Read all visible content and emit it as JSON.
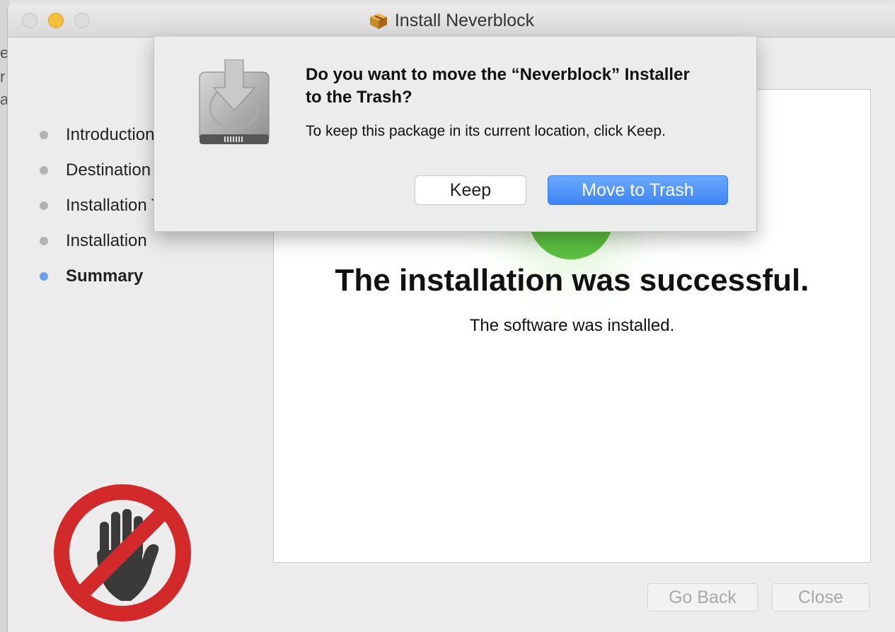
{
  "window": {
    "title": "Install Neverblock"
  },
  "background_window": {
    "letters": [
      "e",
      "r",
      "a"
    ]
  },
  "sidebar": {
    "steps": [
      {
        "label": "Introduction",
        "active": false
      },
      {
        "label": "Destination Select",
        "active": false
      },
      {
        "label": "Installation Type",
        "active": false
      },
      {
        "label": "Installation",
        "active": false
      },
      {
        "label": "Summary",
        "active": true
      }
    ]
  },
  "main": {
    "title": "The installation was successful.",
    "subtitle": "The software was installed."
  },
  "footer": {
    "go_back": "Go Back",
    "close": "Close"
  },
  "dialog": {
    "title": "Do you want to move the “Neverblock” Installer to the Trash?",
    "message": "To keep this package in its current location, click Keep.",
    "keep_label": "Keep",
    "trash_label": "Move to Trash"
  },
  "colors": {
    "accent": "#3e85f6",
    "success_green": "#5bbf3f",
    "stop_red": "#d22a2a",
    "minimize_yellow": "#f5be3b"
  }
}
